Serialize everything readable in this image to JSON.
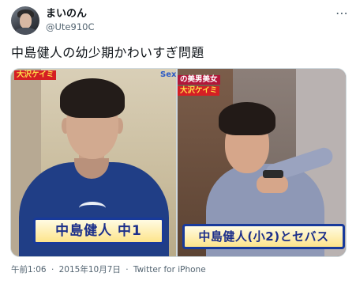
{
  "header": {
    "display_name": "まいのん",
    "handle": "@Ute910C",
    "more_icon": "more-horizontal-icon"
  },
  "tweet": {
    "text": "中島健人の幼少期かわいすぎ問題",
    "timestamp": "午前1:06",
    "date": "2015年10月7日",
    "separator": "·",
    "source": "Twitter for iPhone"
  },
  "media": [
    {
      "tags": [
        "大沢ケイミ",
        "Sex"
      ],
      "caption": "中島健人 中1"
    },
    {
      "tags": [
        "の美男美女",
        "大沢ケイミ"
      ],
      "caption": "中島健人(小2)とセバス"
    }
  ]
}
